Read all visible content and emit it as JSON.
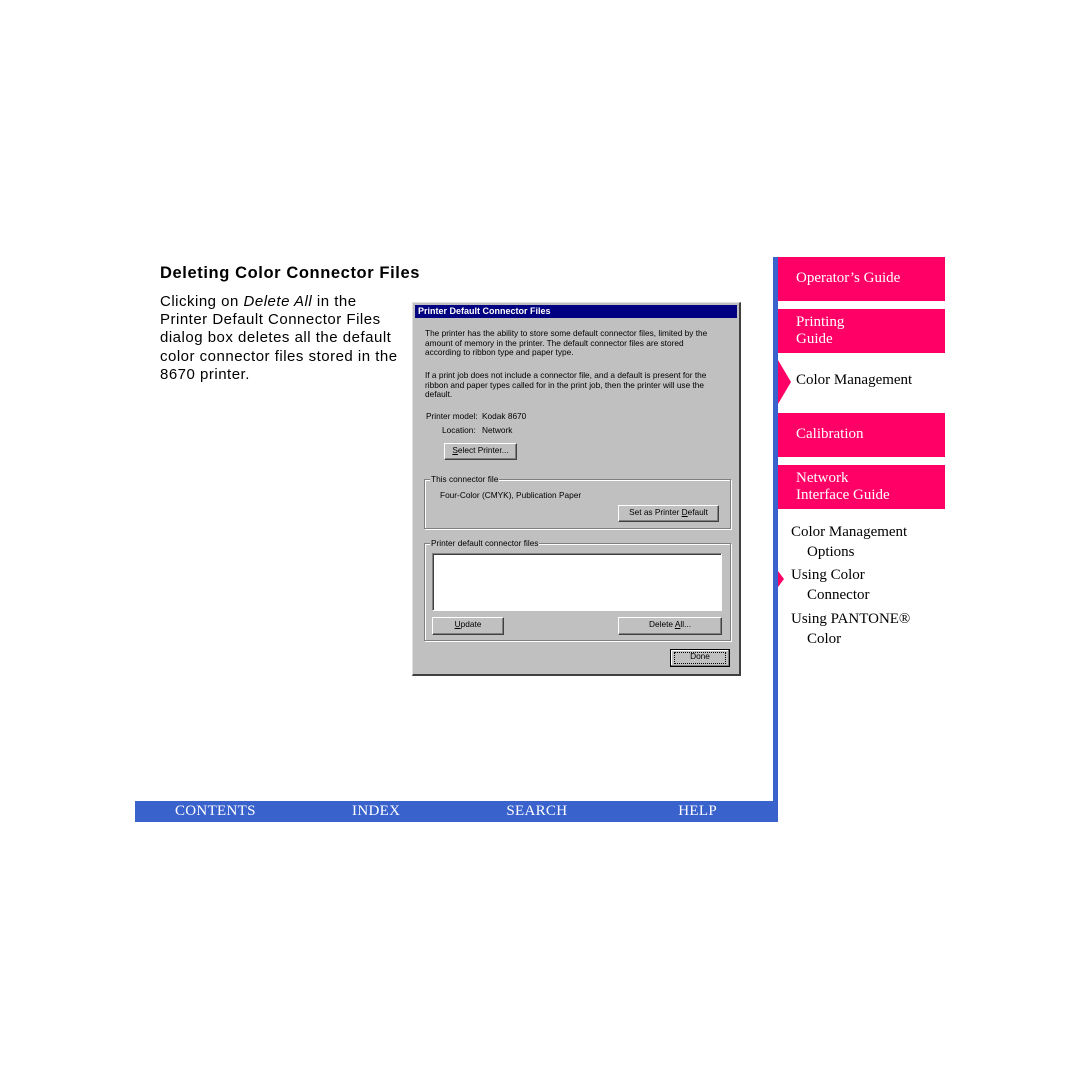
{
  "page": {
    "heading": "Deleting Color Connector Files",
    "body_before": "Clicking on ",
    "body_emphasis": "Delete All",
    "body_after": " in the Printer Default Connector Files dialog box deletes all the default color connector files stored in the 8670 printer."
  },
  "dialog": {
    "title": "Printer Default Connector Files",
    "para1": [
      "The printer has the ability to store some default connector files, limited by the",
      "amount of memory in the printer.  The default connector files are stored",
      "according to ribbon type and paper type."
    ],
    "para2": [
      "If a print job does not include a connector file, and a default is present for the",
      "ribbon and paper types called for in the print job, then the printer will use the",
      "default."
    ],
    "printer_model_label": "Printer model:",
    "printer_model_value": "Kodak 8670",
    "location_label": "Location:",
    "location_value": "Network",
    "select_printer_button": {
      "mnemonic": "S",
      "rest": "elect Printer..."
    },
    "connector_group": {
      "title": "This connector file",
      "value": "Four-Color (CMYK), Publication Paper",
      "set_default_button": {
        "before": "Set as Printer ",
        "mnemonic": "D",
        "after": "efault"
      }
    },
    "defaults_group": {
      "title": "Printer default connector files",
      "items": [],
      "update_button": {
        "mnemonic": "U",
        "rest": "pdate"
      },
      "delete_all_button": {
        "before": "Delete ",
        "mnemonic": "A",
        "after": "ll..."
      }
    },
    "done_button": "Done"
  },
  "sidebar": {
    "guides": [
      {
        "label_line1": "Operator’s Guide",
        "label_line2": ""
      },
      {
        "label_line1": "Printing",
        "label_line2": "Guide"
      },
      {
        "label_line1": "Calibration",
        "label_line2": ""
      },
      {
        "label_line1": "Network",
        "label_line2": "Interface Guide"
      }
    ],
    "current_section": "Color Management",
    "subtopics": [
      {
        "line1": "Color Management",
        "line2": "Options",
        "current": false
      },
      {
        "line1": "Using Color",
        "line2": "Connector",
        "current": true
      },
      {
        "line1": "Using PANTONE®",
        "line2": "Color",
        "current": false
      }
    ],
    "colors": {
      "guide_bg": "#ff0066",
      "rail": "#3a62cc"
    }
  },
  "bottom_nav": {
    "items": [
      "CONTENTS",
      "INDEX",
      "SEARCH",
      "HELP"
    ],
    "color": "#3a62cc"
  }
}
